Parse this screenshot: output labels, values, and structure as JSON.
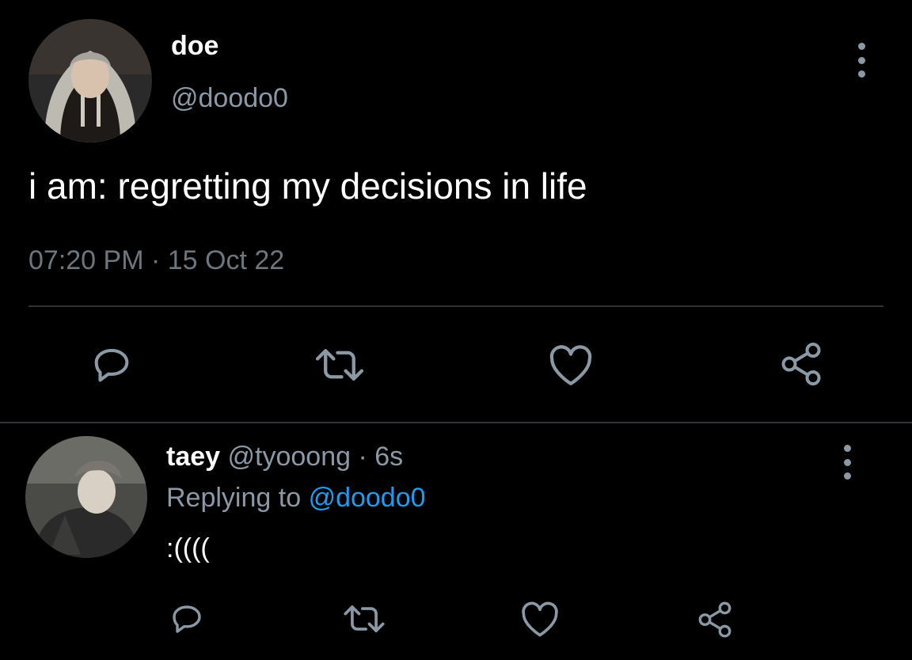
{
  "main_tweet": {
    "display_name": "doe",
    "handle": "@doodo0",
    "text": "i am: regretting my decisions in life",
    "time": "07:20 PM",
    "separator": "·",
    "date": "15 Oct 22"
  },
  "reply": {
    "display_name": "taey",
    "handle": "@tyooong",
    "separator": "·",
    "time_ago": "6s",
    "replying_prefix": "Replying to",
    "replying_to": "@doodo0",
    "text": ":(((("
  },
  "icons": {
    "reply": "reply-icon",
    "retweet": "retweet-icon",
    "like": "heart-icon",
    "share": "share-icon",
    "more": "more-vertical-icon"
  },
  "colors": {
    "background": "#000000",
    "primary_text": "#ffffff",
    "secondary_text": "#8b98a5",
    "link": "#1d9bf0",
    "divider": "#2f3336"
  }
}
